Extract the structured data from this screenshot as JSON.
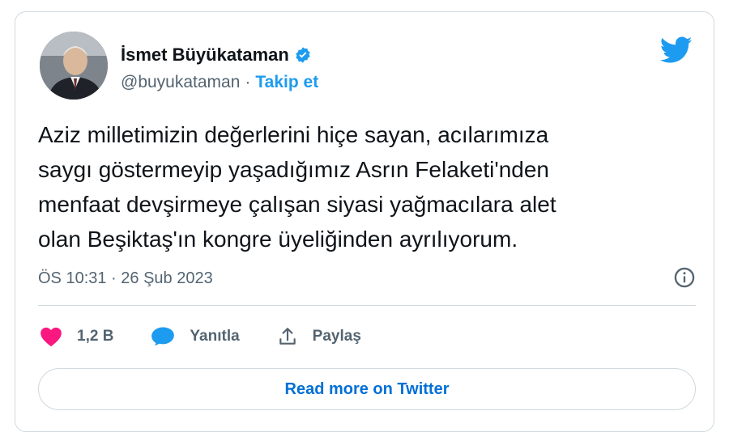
{
  "author": {
    "name": "İsmet Büyükataman",
    "handle": "@buyukataman",
    "separator": "·",
    "follow_label": "Takip et",
    "verified_color": "#1d9bf0",
    "avatar_icon": "person-avatar"
  },
  "brand": {
    "icon": "twitter-bird-icon",
    "color": "#1d9bf0"
  },
  "tweet": {
    "text": "Aziz milletimizin değerlerini hiçe sayan, acılarımıza\nsaygı göstermeyip yaşadığımız Asrın Felaketi'nden\nmenfaat devşirmeye çalışan siyasi yağmacılara alet\nolan Beşiktaş'ın kongre üyeliğinden ayrılıyorum.",
    "timestamp": "ÖS 10:31 · 26 Şub 2023"
  },
  "actions": {
    "likes": "1,2 B",
    "reply_label": "Yanıtla",
    "share_label": "Paylaş",
    "like_color": "#f91880",
    "reply_color": "#1d9bf0"
  },
  "footer": {
    "read_more_label": "Read more on Twitter"
  }
}
